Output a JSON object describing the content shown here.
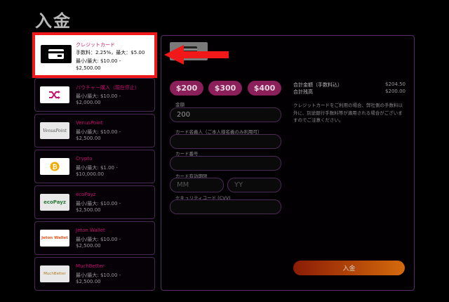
{
  "page": {
    "title": "入金"
  },
  "methods": [
    {
      "name": "クレジットカード",
      "line1": "手数料：2.25%，最大：$5.00",
      "line2": "最小/最大: $10.00 -",
      "line3": "$2,500.00",
      "icon": "credit-card-icon",
      "selected": true
    },
    {
      "name": "バウチャー購入（現在停止）",
      "line1": "最小/最大: $10.00 -",
      "line2": "$2,000.00",
      "icon": "shuffle-icon"
    },
    {
      "name": "VenusPoint",
      "line1": "最小/最大: $10.00 -",
      "line2": "$2,500.00",
      "icon": "venuspoint-logo",
      "logo_text": "VenusPoint"
    },
    {
      "name": "Crypto",
      "line1": "最小/最大: $1.00 -",
      "line2": "$10,000.00",
      "icon": "bitcoin-icon"
    },
    {
      "name": "ecoPayz",
      "line1": "最小/最大: $10.00 -",
      "line2": "$2,500.00",
      "icon": "ecopayz-logo",
      "logo_text": "ecoPayz"
    },
    {
      "name": "Jeton Wallet",
      "line1": "最小/最大: $10.00 -",
      "line2": "$2,500.00",
      "icon": "jeton-logo",
      "logo_text": "Jeton Wallet"
    },
    {
      "name": "MuchBetter",
      "line1": "最小/最大: $10.00 -",
      "line2": "$2,500.00",
      "icon": "muchbetter-logo",
      "logo_text": "MuchBetter"
    }
  ],
  "amount_buttons": [
    "$200",
    "$300",
    "$400"
  ],
  "form": {
    "amount_label": "金額",
    "amount_value": "200",
    "holder_label": "カード名義人（ご本人様名義のみ利用可）",
    "number_label": "カード番号",
    "expiry_label": "カード有効期限",
    "month_placeholder": "MM",
    "year_placeholder": "YY",
    "cvv_label": "セキュリティコード (CVV)"
  },
  "summary": {
    "total_label": "合計金額（手数料込）",
    "total_value": "$204.50",
    "balance_label": "合計残高",
    "balance_value": "$200.00",
    "note": "クレジットカードをご利用の場合、弊社側の手数料以外に、別途銀行手数料等が適用される場合がございますのでご注意ください。"
  },
  "deposit_label": "入金",
  "colors": {
    "accent": "#8a1f5a",
    "highlight": "#f01818",
    "label_pink": "#c4106f"
  }
}
